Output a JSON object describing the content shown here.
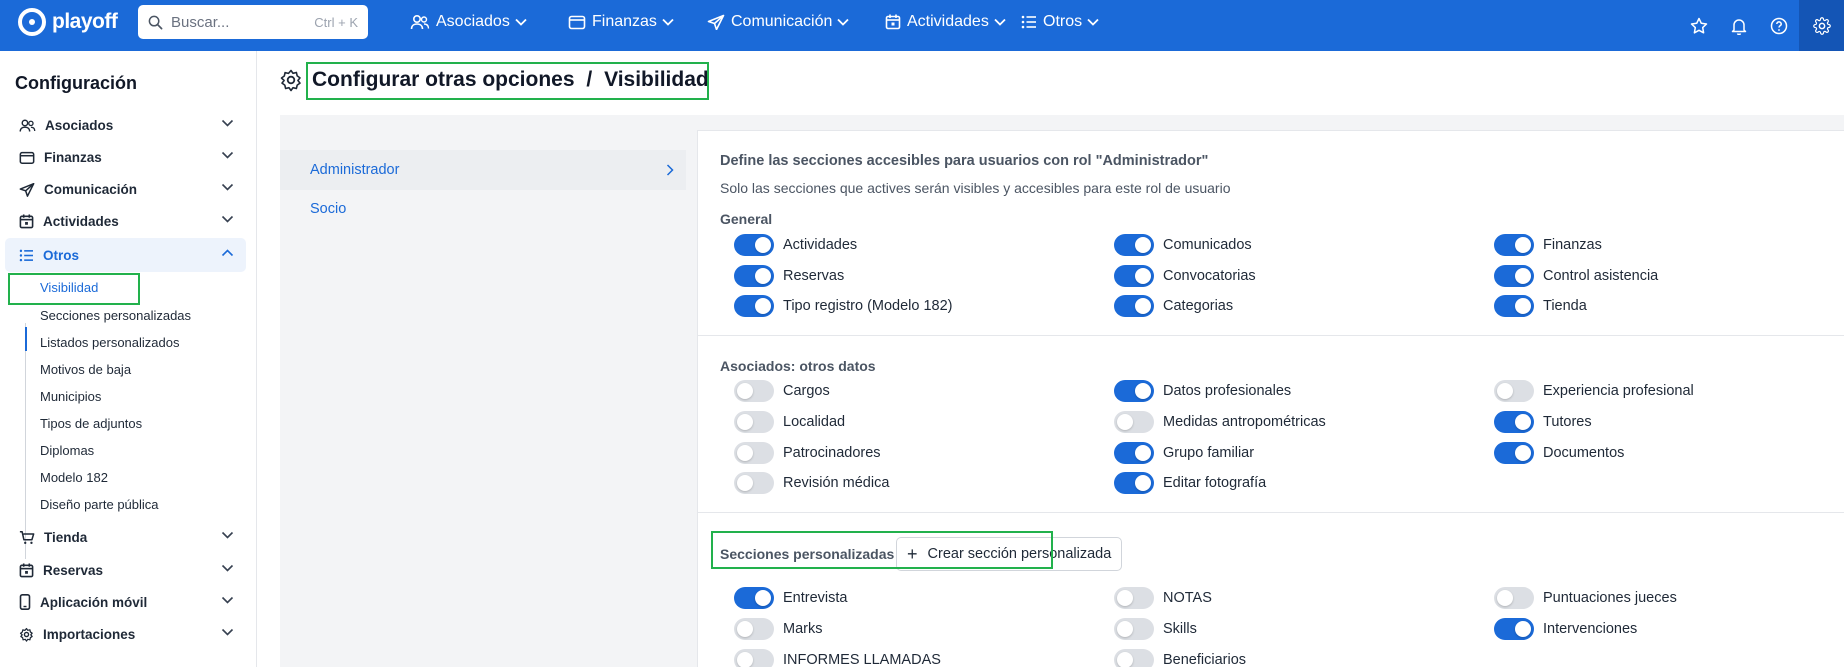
{
  "app": {
    "brand": "playoff"
  },
  "search": {
    "placeholder": "Buscar...",
    "shortcut": "Ctrl + K"
  },
  "topnav": [
    {
      "label": "Asociados",
      "icon": "users-icon"
    },
    {
      "label": "Finanzas",
      "icon": "wallet-icon"
    },
    {
      "label": "Comunicación",
      "icon": "send-icon"
    },
    {
      "label": "Actividades",
      "icon": "calendar-icon"
    },
    {
      "label": "Otros",
      "icon": "list-icon"
    }
  ],
  "sidebar": {
    "title": "Configuración",
    "items": [
      {
        "label": "Asociados",
        "icon": "users-icon"
      },
      {
        "label": "Finanzas",
        "icon": "wallet-icon"
      },
      {
        "label": "Comunicación",
        "icon": "send-icon"
      },
      {
        "label": "Actividades",
        "icon": "calendar-icon"
      },
      {
        "label": "Otros",
        "icon": "list-icon",
        "expanded": true
      },
      {
        "label": "Tienda",
        "icon": "cart-icon"
      },
      {
        "label": "Reservas",
        "icon": "calendar-icon"
      },
      {
        "label": "Aplicación móvil",
        "icon": "phone-icon"
      },
      {
        "label": "Importaciones",
        "icon": "gear-icon"
      }
    ],
    "subitems": [
      "Visibilidad",
      "Secciones personalizadas",
      "Listados personalizados",
      "Motivos de baja",
      "Municipios",
      "Tipos de adjuntos",
      "Diplomas",
      "Modelo 182",
      "Diseño parte pública"
    ],
    "active_subitem": "Visibilidad"
  },
  "page": {
    "title": "Configurar otras opciones",
    "separator": "/",
    "section": "Visibilidad"
  },
  "roles": [
    {
      "label": "Administrador",
      "selected": true
    },
    {
      "label": "Socio",
      "selected": false
    }
  ],
  "panel": {
    "heading": "Define las secciones accesibles para usuarios con rol \"Administrador\"",
    "subheading": "Solo las secciones que actives serán visibles y accesibles para este rol de usuario",
    "sections": [
      {
        "title": "General",
        "toggles": [
          {
            "label": "Actividades",
            "on": true
          },
          {
            "label": "Comunicados",
            "on": true
          },
          {
            "label": "Finanzas",
            "on": true
          },
          {
            "label": "Reservas",
            "on": true
          },
          {
            "label": "Convocatorias",
            "on": true
          },
          {
            "label": "Control asistencia",
            "on": true
          },
          {
            "label": "Tipo registro (Modelo 182)",
            "on": true
          },
          {
            "label": "Categorias",
            "on": true
          },
          {
            "label": "Tienda",
            "on": true
          }
        ]
      },
      {
        "title": "Asociados: otros datos",
        "toggles": [
          {
            "label": "Cargos",
            "on": false
          },
          {
            "label": "Datos profesionales",
            "on": true
          },
          {
            "label": "Experiencia profesional",
            "on": false
          },
          {
            "label": "Localidad",
            "on": false
          },
          {
            "label": "Medidas antropométricas",
            "on": false
          },
          {
            "label": "Tutores",
            "on": true
          },
          {
            "label": "Patrocinadores",
            "on": false
          },
          {
            "label": "Grupo familiar",
            "on": true
          },
          {
            "label": "Documentos",
            "on": true
          },
          {
            "label": "Revisión médica",
            "on": false
          },
          {
            "label": "Editar fotografía",
            "on": true
          }
        ]
      },
      {
        "title": "Secciones personalizadas",
        "button": "Crear sección personalizada",
        "toggles": [
          {
            "label": "Entrevista",
            "on": true
          },
          {
            "label": "NOTAS",
            "on": false
          },
          {
            "label": "Puntuaciones jueces",
            "on": false
          },
          {
            "label": "Marks",
            "on": false
          },
          {
            "label": "Skills",
            "on": false
          },
          {
            "label": "Intervenciones",
            "on": true
          },
          {
            "label": "INFORMES LLAMADAS",
            "on": false
          },
          {
            "label": "Beneficiarios",
            "on": false
          }
        ]
      }
    ]
  },
  "colors": {
    "brand": "#1b6ad8",
    "highlight": "#22b14c",
    "toggle_off": "#dcdfe4"
  }
}
